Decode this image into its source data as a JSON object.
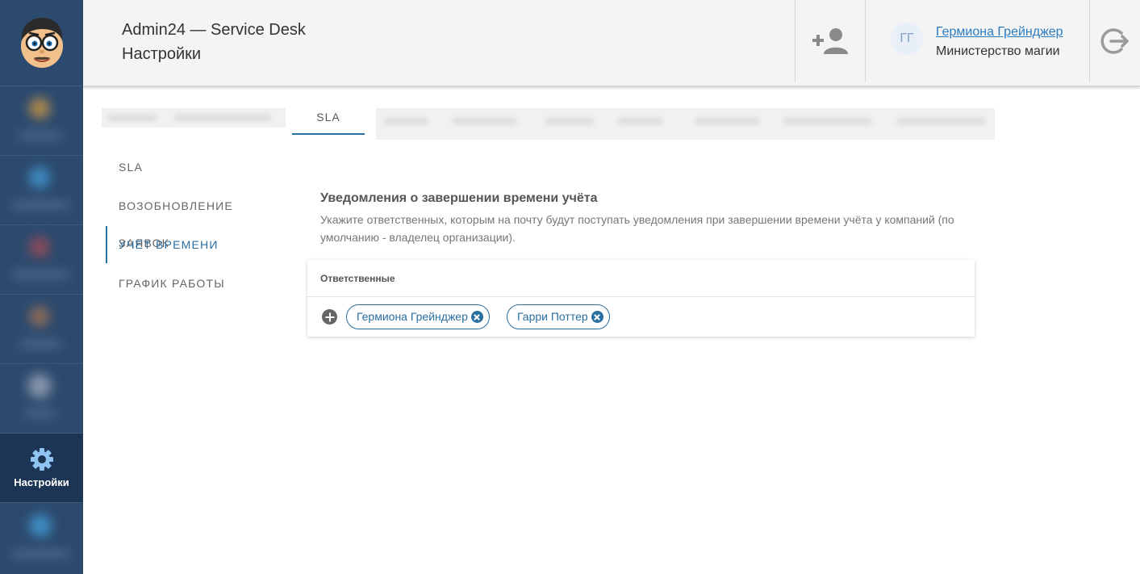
{
  "header": {
    "app_title": "Admin24 — Service Desk",
    "page_title": "Настройки",
    "user_initials": "ГГ",
    "user_name": "Гермиона Грейнджер",
    "user_org": "Министерство магии",
    "add_user_icon": "add-user-icon",
    "logout_icon": "logout-icon"
  },
  "sidebar": {
    "logo_icon": "nerd-face-logo",
    "active_item": {
      "icon": "gear-icon",
      "label": "Настройки"
    }
  },
  "top_tabs": {
    "active": "SLA"
  },
  "menu": {
    "items": [
      "SLA",
      "ВОЗОБНОВЛЕНИЕ ЗАЯВОК",
      "УЧЁТ ВРЕМЕНИ",
      "ГРАФИК РАБОТЫ"
    ],
    "active_index": 2
  },
  "section": {
    "title": "Уведомления о завершении времени учёта",
    "description": "Укажите ответственных, которым на почту будут поступать уведомления при завершении времени учёта у компаний (по умолчанию - владелец организации).",
    "card_header": "Ответственные",
    "add_icon": "plus-circle-icon",
    "responsibles": [
      "Гермиона Грейнджер",
      "Гарри Поттер"
    ]
  },
  "colors": {
    "accent": "#2a6ea0",
    "link": "#2a7bc0",
    "rail": "#2c4a6e",
    "rail_active": "#1d3554",
    "header_bg": "#f4f4f4"
  }
}
